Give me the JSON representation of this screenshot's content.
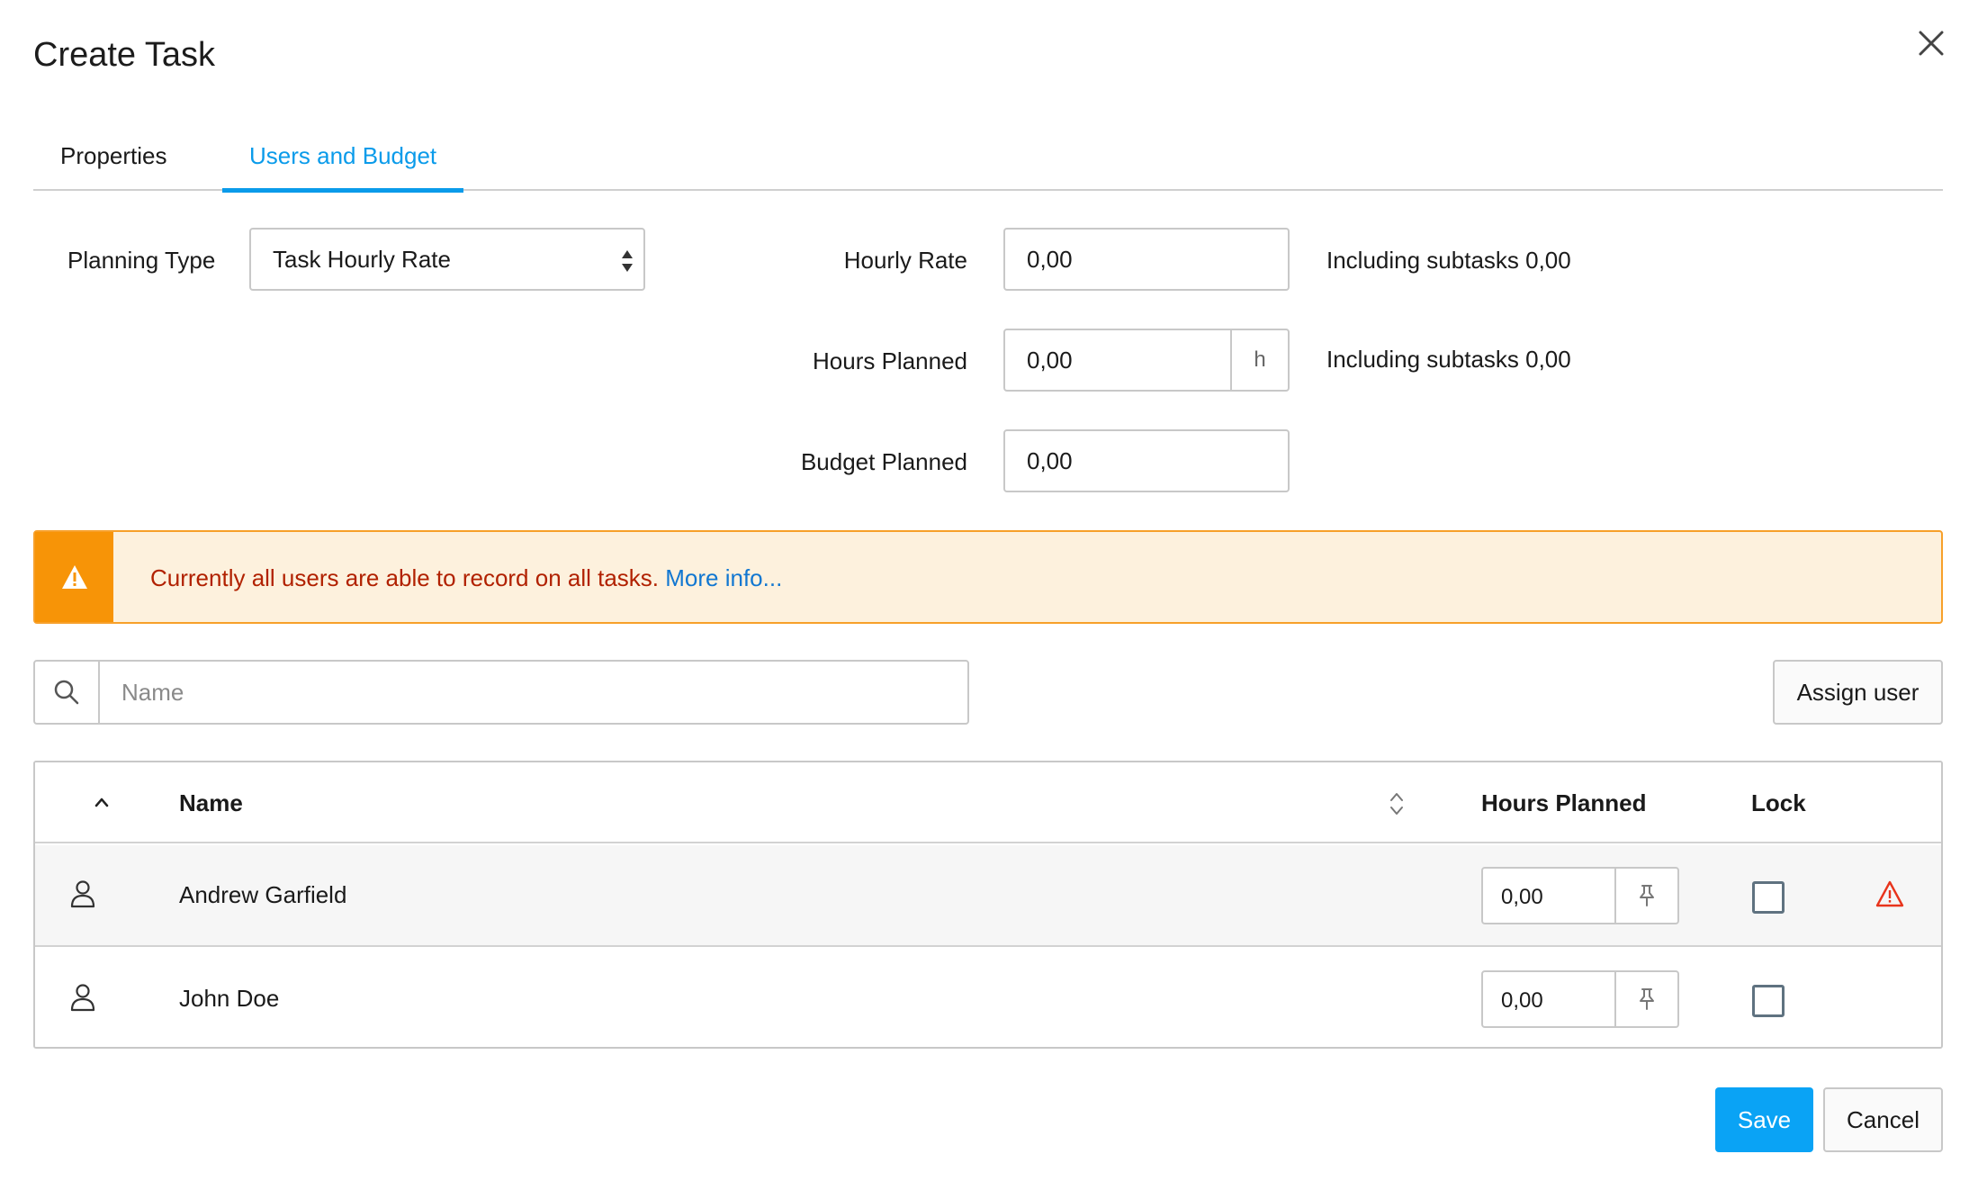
{
  "dialog": {
    "title": "Create Task"
  },
  "tabs": [
    {
      "label": "Properties",
      "active": false
    },
    {
      "label": "Users and Budget",
      "active": true
    }
  ],
  "form": {
    "planning_type_label": "Planning Type",
    "planning_type_value": "Task Hourly Rate",
    "hourly_rate_label": "Hourly Rate",
    "hourly_rate_value": "0,00",
    "hourly_rate_note": "Including subtasks 0,00",
    "hours_planned_label": "Hours Planned",
    "hours_planned_value": "0,00",
    "hours_unit": "h",
    "hours_planned_note": "Including subtasks 0,00",
    "budget_planned_label": "Budget Planned",
    "budget_planned_value": "0,00"
  },
  "alert": {
    "message": "Currently all users are able to record on all tasks.",
    "link": "More info..."
  },
  "search": {
    "placeholder": "Name"
  },
  "buttons": {
    "assign_user": "Assign user",
    "save": "Save",
    "cancel": "Cancel"
  },
  "table": {
    "columns": {
      "name": "Name",
      "hours_planned": "Hours Planned",
      "lock": "Lock"
    },
    "rows": [
      {
        "name": "Andrew Garfield",
        "hours": "0,00",
        "locked": false,
        "warning": true
      },
      {
        "name": "John Doe",
        "hours": "0,00",
        "locked": false,
        "warning": false
      }
    ]
  },
  "colors": {
    "accent": "#0a9bea",
    "save_button": "#0aa3f5",
    "warning_orange": "#f79407",
    "alert_bg": "#fdf1dd",
    "alert_text": "#b12100",
    "link": "#1177d1"
  },
  "icons": [
    "close-icon",
    "select-arrows-icon",
    "warning-icon",
    "search-icon",
    "sort-up-icon",
    "sort-toggle-icon",
    "user-icon",
    "pin-icon"
  ]
}
